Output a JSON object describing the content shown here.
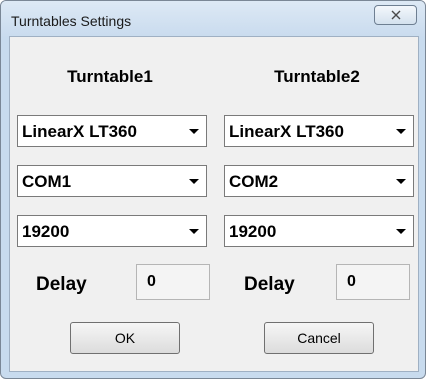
{
  "window": {
    "title": "Turntables Settings",
    "close_icon": "close-icon"
  },
  "turntable1": {
    "header": "Turntable1",
    "model": "LinearX LT360",
    "port": "COM1",
    "baud": "19200",
    "delay_label": "Delay",
    "delay_value": "0"
  },
  "turntable2": {
    "header": "Turntable2",
    "model": "LinearX LT360",
    "port": "COM2",
    "baud": "19200",
    "delay_label": "Delay",
    "delay_value": "0"
  },
  "buttons": {
    "ok": "OK",
    "cancel": "Cancel"
  }
}
